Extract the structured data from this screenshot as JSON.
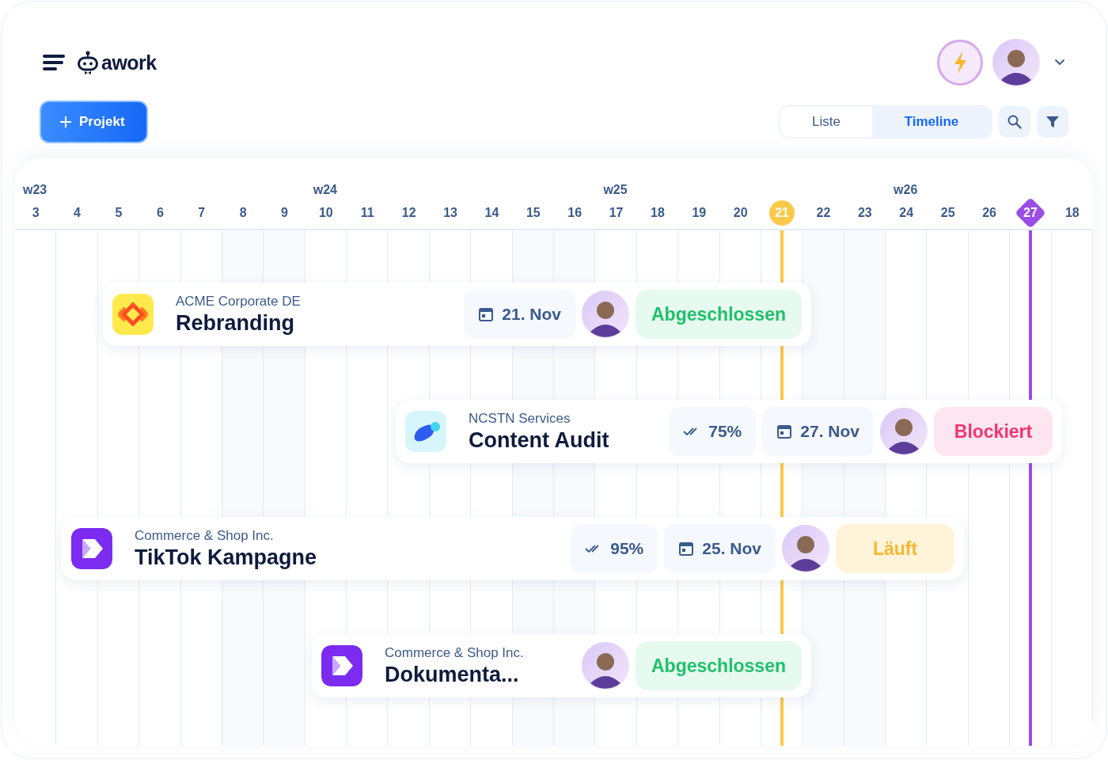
{
  "header": {
    "logo_text": "awork",
    "new_button": "Projekt",
    "views": [
      {
        "label": "Liste",
        "selected": false
      },
      {
        "label": "Timeline",
        "selected": true
      }
    ]
  },
  "timeline": {
    "days": [
      {
        "label": "3",
        "week_label": "w23",
        "kind": "workday"
      },
      {
        "label": "4",
        "kind": "workday"
      },
      {
        "label": "5",
        "kind": "workday"
      },
      {
        "label": "6",
        "kind": "workday"
      },
      {
        "label": "7",
        "kind": "workday"
      },
      {
        "label": "8",
        "kind": "weekend"
      },
      {
        "label": "9",
        "kind": "weekend"
      },
      {
        "label": "10",
        "week_label": "w24",
        "kind": "workday"
      },
      {
        "label": "11",
        "kind": "workday"
      },
      {
        "label": "12",
        "kind": "workday"
      },
      {
        "label": "13",
        "kind": "workday"
      },
      {
        "label": "14",
        "kind": "workday"
      },
      {
        "label": "15",
        "kind": "weekend"
      },
      {
        "label": "16",
        "kind": "weekend"
      },
      {
        "label": "17",
        "week_label": "w25",
        "kind": "workday"
      },
      {
        "label": "18",
        "kind": "workday"
      },
      {
        "label": "19",
        "kind": "workday"
      },
      {
        "label": "20",
        "kind": "workday"
      },
      {
        "label": "21",
        "kind": "today"
      },
      {
        "label": "22",
        "kind": "weekend"
      },
      {
        "label": "23",
        "kind": "weekend"
      },
      {
        "label": "24",
        "week_label": "w26",
        "kind": "workday"
      },
      {
        "label": "25",
        "kind": "workday"
      },
      {
        "label": "26",
        "kind": "workday"
      },
      {
        "label": "27",
        "kind": "milestone"
      },
      {
        "label": "18",
        "kind": "workday"
      }
    ]
  },
  "projects": [
    {
      "client": "ACME Corporate DE",
      "title": "Rebranding",
      "logo": {
        "kind": "diamond"
      },
      "due": "21. Nov",
      "status": {
        "label": "Abgeschlossen",
        "kind": "done"
      }
    },
    {
      "client": "NCSTN Services",
      "title": "Content Audit",
      "logo": {
        "kind": "blob"
      },
      "progress": "75%",
      "due": "27. Nov",
      "status": {
        "label": "Blockiert",
        "kind": "blocked"
      }
    },
    {
      "client": "Commerce & Shop Inc.",
      "title": "TikTok Kampagne",
      "logo": {
        "kind": "chevron"
      },
      "progress": "95%",
      "due": "25. Nov",
      "status": {
        "label": "Läuft",
        "kind": "running"
      }
    },
    {
      "client": "Commerce & Shop Inc.",
      "title": "Dokumenta...",
      "logo": {
        "kind": "chevron"
      },
      "status": {
        "label": "Abgeschlossen",
        "kind": "done"
      }
    }
  ]
}
